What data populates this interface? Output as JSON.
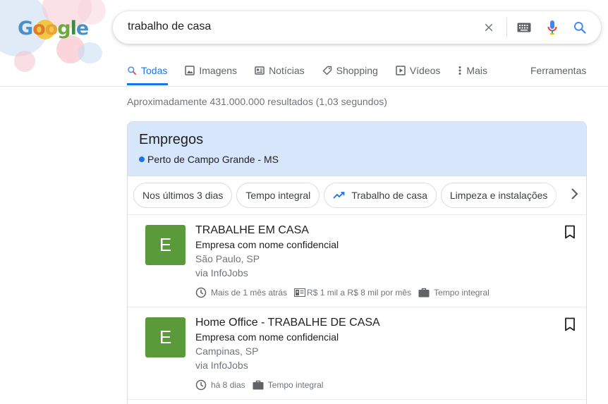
{
  "doodle": {
    "letters": [
      "G",
      "o",
      "o",
      "g",
      "l",
      "e"
    ]
  },
  "search": {
    "query": "trabalho de casa"
  },
  "tabs": [
    {
      "label": "Todas",
      "icon": "search-icon"
    },
    {
      "label": "Imagens",
      "icon": "image-icon"
    },
    {
      "label": "Notícias",
      "icon": "news-icon"
    },
    {
      "label": "Shopping",
      "icon": "tag-icon"
    },
    {
      "label": "Vídeos",
      "icon": "play-icon"
    },
    {
      "label": "Mais",
      "icon": "more-vert-icon"
    }
  ],
  "tools_label": "Ferramentas",
  "result_stats": "Aproximadamente 431.000.000 resultados (1,03 segundos)",
  "jobs": {
    "title": "Empregos",
    "location": "Perto de Campo Grande - MS",
    "chips": [
      "Nos últimos 3 dias",
      "Tempo integral",
      "Trabalho de casa",
      "Limpeza e instalações"
    ],
    "listings": [
      {
        "logo_letter": "E",
        "title": "TRABALHE EM CASA",
        "company": "Empresa com nome confidencial",
        "location": "São Paulo, SP",
        "via": "via InfoJobs",
        "posted": "Mais de 1 mês atrás",
        "salary": "R$ 1 mil a R$ 8 mil por mês",
        "type": "Tempo integral"
      },
      {
        "logo_letter": "E",
        "title": "Home Office - TRABALHE DE CASA",
        "company": "Empresa com nome confidencial",
        "location": "Campinas, SP",
        "via": "via InfoJobs",
        "posted": "há 8 dias",
        "type": "Tempo integral"
      }
    ]
  },
  "colors": {
    "accent": "#1a73e8",
    "jobs_header_bg": "#d8e6fb",
    "logo_green": "#5b9a3a"
  }
}
